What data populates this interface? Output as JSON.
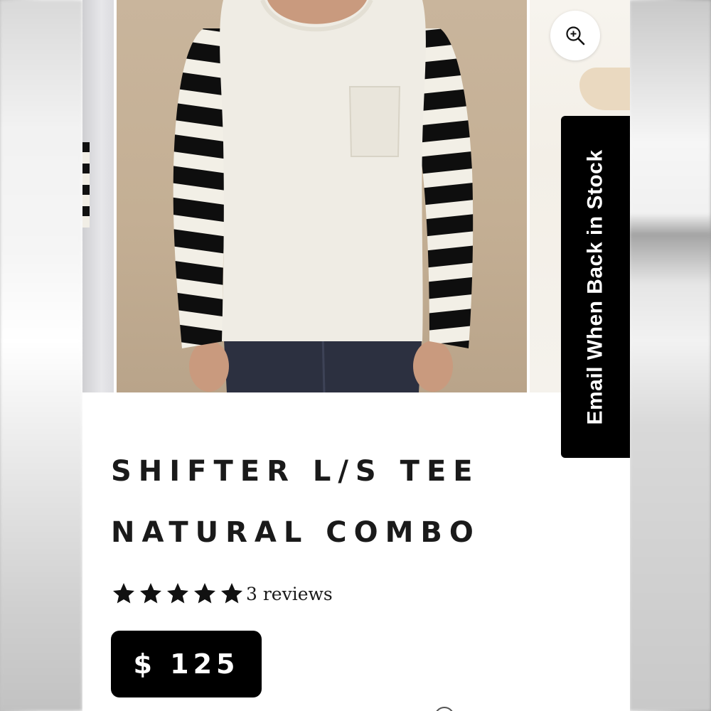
{
  "product": {
    "title_line1": "SHIFTER L/S TEE",
    "title_line2": "NATURAL COMBO",
    "rating_stars": 5,
    "rating_max": 5,
    "reviews_label": "3 reviews",
    "price": "$ 125"
  },
  "email_tab_label": "Email When Back in Stock",
  "icons": {
    "zoom": "zoom-in-icon",
    "star": "star-icon"
  },
  "colors": {
    "accent": "#000000",
    "text": "#1a1a1a",
    "background": "#ffffff"
  }
}
